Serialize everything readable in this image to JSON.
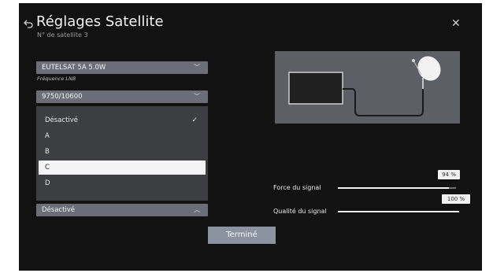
{
  "header": {
    "title": "Réglages Satellite",
    "subtitle": "N° de satellite 3"
  },
  "satellite": {
    "selected": "EUTELSAT 5A 5.0W"
  },
  "lnb": {
    "label": "Fréquence LNB",
    "selected": "9750/10600"
  },
  "diseqc_list": {
    "items": [
      "Désactivé",
      "A",
      "B",
      "C",
      "D"
    ],
    "highlighted_index": 3,
    "checked_index": 0
  },
  "bottom_dropdown": {
    "selected": "Désactivé"
  },
  "signal": {
    "strength_label": "Force du signal",
    "strength_value": "94 %",
    "strength_level": 0.94,
    "quality_label": "Qualité du signal",
    "quality_value": "100 %",
    "quality_level": 1.0
  },
  "done_button": "Terminé",
  "icons": [
    "back-icon",
    "close-icon",
    "chevron-down-icon",
    "chevron-up-icon",
    "check-icon"
  ]
}
